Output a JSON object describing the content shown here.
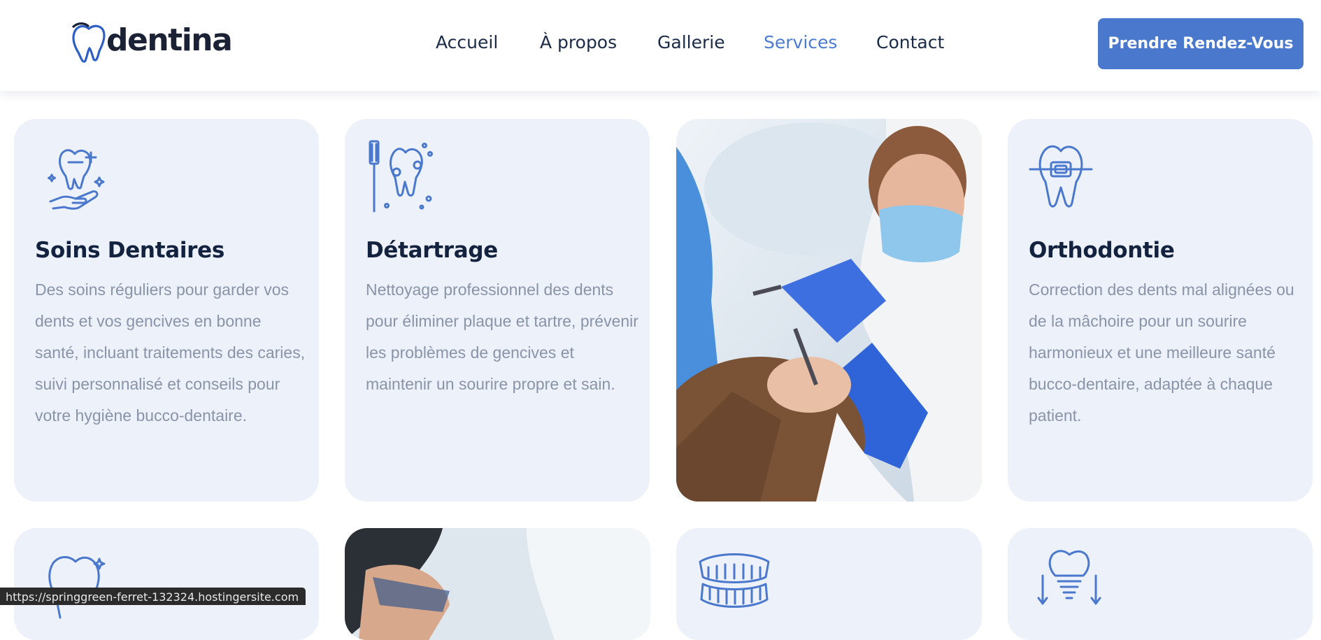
{
  "brand": {
    "name": "dentina"
  },
  "nav": {
    "items": [
      {
        "label": "Accueil"
      },
      {
        "label": "À propos"
      },
      {
        "label": "Gallerie"
      },
      {
        "label": "Services"
      },
      {
        "label": "Contact"
      }
    ],
    "active": "Services"
  },
  "cta": {
    "label": "Prendre Rendez-Vous"
  },
  "services": [
    {
      "icon": "tooth-care-hand-icon",
      "title": "Soins Dentaires",
      "description": "Des soins réguliers pour garder vos dents et vos gencives en bonne santé, incluant traitements des caries, suivi personnalisé et conseils pour votre hygiène bucco-dentaire."
    },
    {
      "icon": "toothbrush-tooth-icon",
      "title": "Détartrage",
      "description": "Nettoyage professionnel des dents pour éliminer plaque et tartre, prévenir les problèmes de gencives et maintenir un sourire propre et sain."
    },
    {
      "icon": "tooth-braces-icon",
      "title": "Orthodontie",
      "description": "Correction des dents mal alignées ou de la mâchoire pour un sourire harmonieux et une meilleure santé bucco-dentaire, adaptée à chaque patient."
    }
  ],
  "second_row_icons": [
    "sparkling-tooth-icon",
    "dentures-icon",
    "dental-implant-icon"
  ],
  "status_url": "https://springgreen-ferret-132324.hostingersite.com",
  "colors": {
    "accent": "#4a78cd",
    "card_bg": "#edf1fa",
    "heading": "#13223f",
    "body_text": "#8a94a8"
  }
}
